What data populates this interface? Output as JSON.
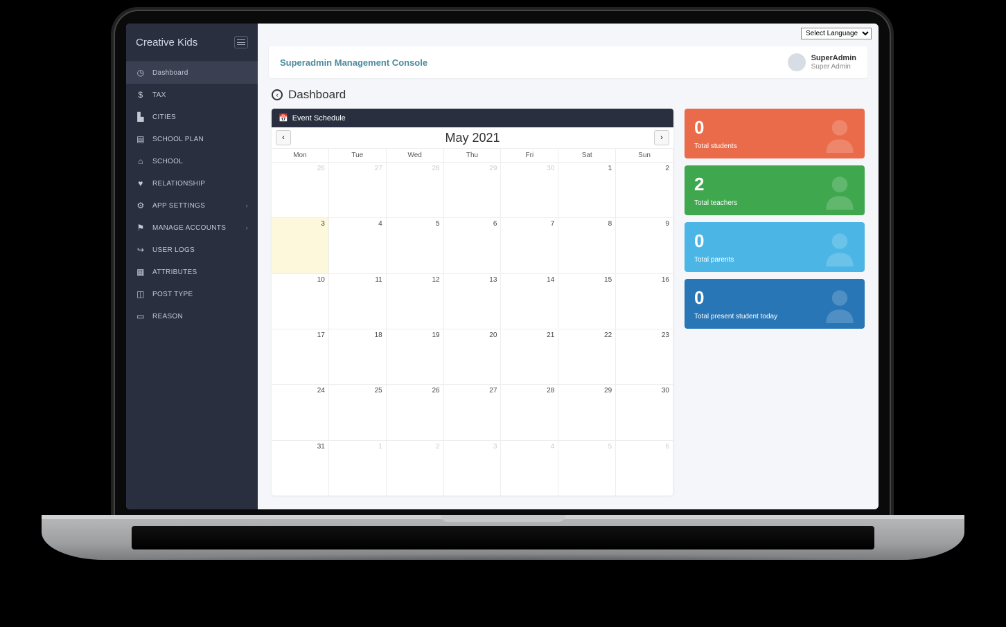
{
  "language_select": "Select Language",
  "brand": "Creative Kids",
  "sidebar": {
    "items": [
      {
        "icon": "◷",
        "label": "Dashboard",
        "active": true
      },
      {
        "icon": "$",
        "label": "TAX"
      },
      {
        "icon": "▙",
        "label": "CITIES"
      },
      {
        "icon": "▤",
        "label": "SCHOOL PLAN"
      },
      {
        "icon": "⌂",
        "label": "SCHOOL"
      },
      {
        "icon": "♥",
        "label": "RELATIONSHIP"
      },
      {
        "icon": "⚙",
        "label": "APP SETTINGS",
        "expandable": true
      },
      {
        "icon": "⚑",
        "label": "MANAGE ACCOUNTS",
        "expandable": true
      },
      {
        "icon": "↪",
        "label": "USER LOGS"
      },
      {
        "icon": "▦",
        "label": "ATTRIBUTES"
      },
      {
        "icon": "◫",
        "label": "POST TYPE"
      },
      {
        "icon": "▭",
        "label": "REASON"
      }
    ]
  },
  "header": {
    "title": "Superadmin Management Console",
    "user_name": "SuperAdmin",
    "user_role": "Super Admin"
  },
  "page": {
    "title": "Dashboard"
  },
  "calendar": {
    "title": "Event Schedule",
    "month": "May 2021",
    "dow": [
      "Mon",
      "Tue",
      "Wed",
      "Thu",
      "Fri",
      "Sat",
      "Sun"
    ],
    "weeks": [
      [
        {
          "n": "26",
          "o": true
        },
        {
          "n": "27",
          "o": true
        },
        {
          "n": "28",
          "o": true
        },
        {
          "n": "29",
          "o": true
        },
        {
          "n": "30",
          "o": true
        },
        {
          "n": "1"
        },
        {
          "n": "2"
        }
      ],
      [
        {
          "n": "3",
          "today": true
        },
        {
          "n": "4"
        },
        {
          "n": "5"
        },
        {
          "n": "6"
        },
        {
          "n": "7"
        },
        {
          "n": "8"
        },
        {
          "n": "9"
        }
      ],
      [
        {
          "n": "10"
        },
        {
          "n": "11"
        },
        {
          "n": "12"
        },
        {
          "n": "13"
        },
        {
          "n": "14"
        },
        {
          "n": "15"
        },
        {
          "n": "16"
        }
      ],
      [
        {
          "n": "17"
        },
        {
          "n": "18"
        },
        {
          "n": "19"
        },
        {
          "n": "20"
        },
        {
          "n": "21"
        },
        {
          "n": "22"
        },
        {
          "n": "23"
        }
      ],
      [
        {
          "n": "24"
        },
        {
          "n": "25"
        },
        {
          "n": "26"
        },
        {
          "n": "27"
        },
        {
          "n": "28"
        },
        {
          "n": "29"
        },
        {
          "n": "30"
        }
      ],
      [
        {
          "n": "31"
        },
        {
          "n": "1",
          "o": true
        },
        {
          "n": "2",
          "o": true
        },
        {
          "n": "3",
          "o": true
        },
        {
          "n": "4",
          "o": true
        },
        {
          "n": "5",
          "o": true
        },
        {
          "n": "6",
          "o": true
        }
      ]
    ]
  },
  "stats": [
    {
      "value": "0",
      "label": "Total students",
      "cls": "s1"
    },
    {
      "value": "2",
      "label": "Total teachers",
      "cls": "s2"
    },
    {
      "value": "0",
      "label": "Total parents",
      "cls": "s3"
    },
    {
      "value": "0",
      "label": "Total present student today",
      "cls": "s4"
    }
  ]
}
